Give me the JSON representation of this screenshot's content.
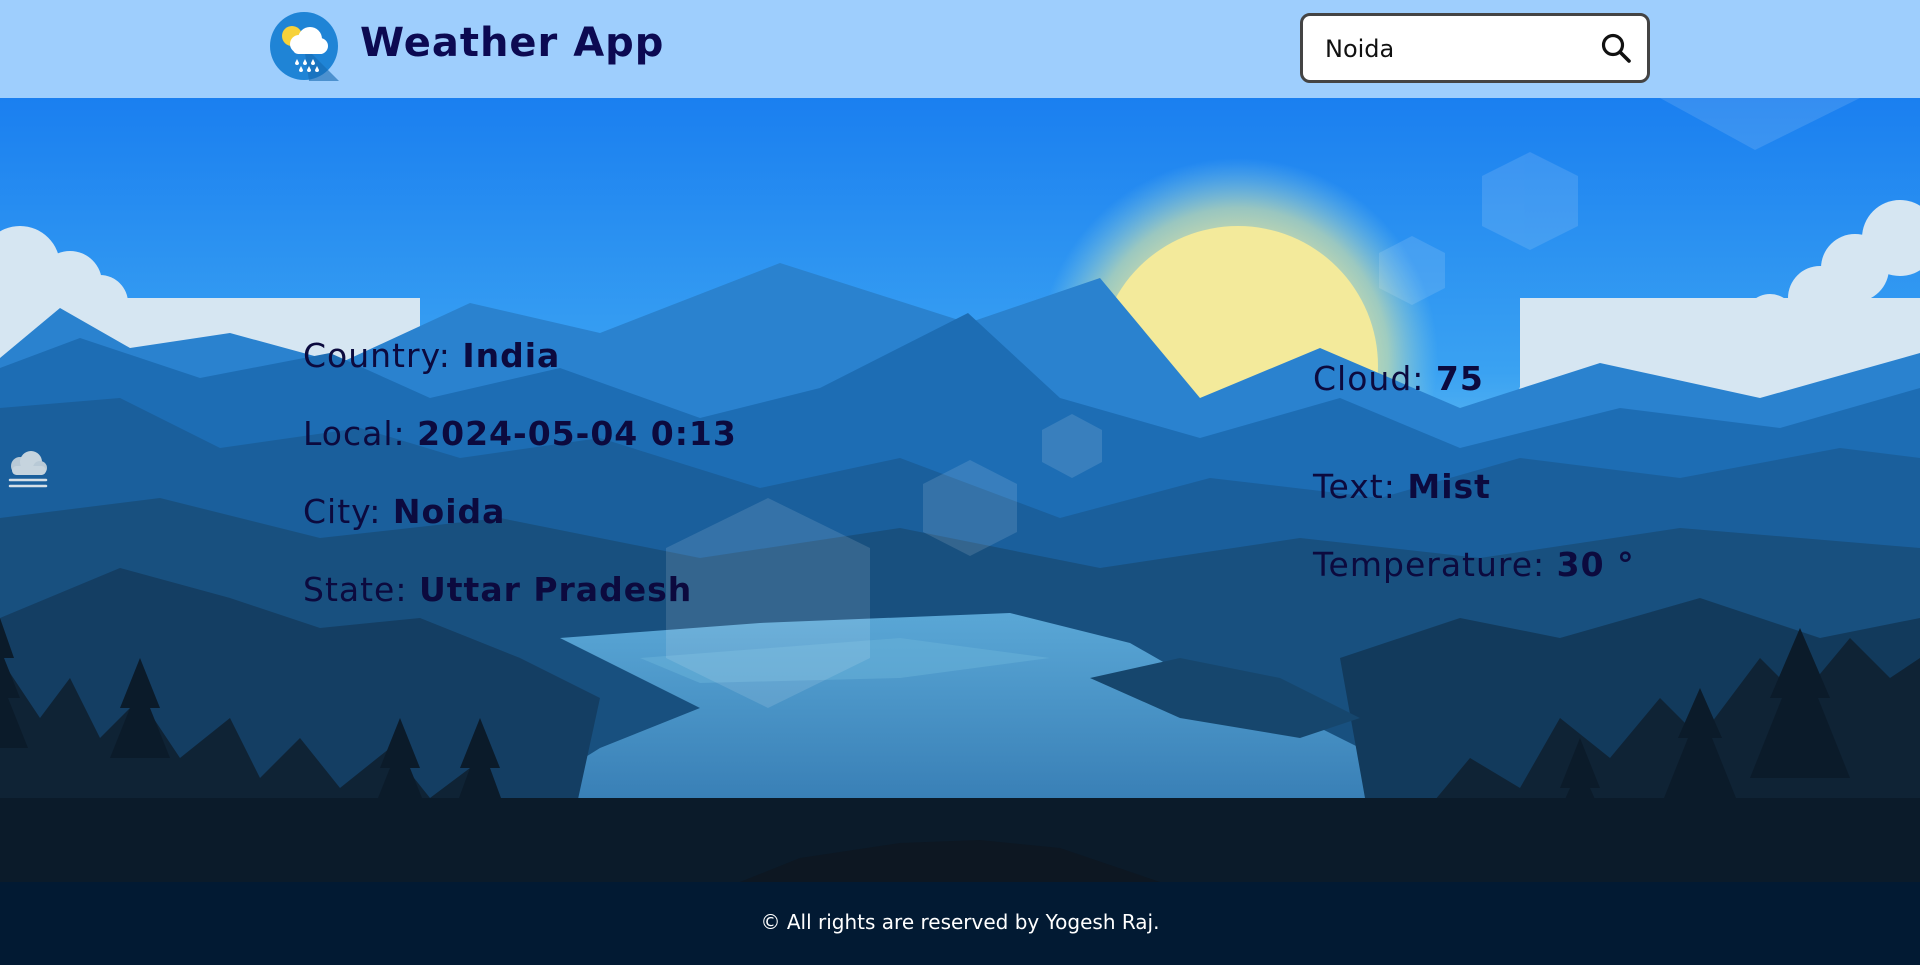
{
  "header": {
    "title": "Weather App",
    "search": {
      "value": "Noida",
      "placeholder": ""
    }
  },
  "location": {
    "country": {
      "label": "Country:",
      "value": "India"
    },
    "local": {
      "label": "Local:",
      "value": "2024-05-04 0:13"
    },
    "city": {
      "label": "City:",
      "value": "Noida"
    },
    "state": {
      "label": "State:",
      "value": "Uttar Pradesh"
    }
  },
  "weather": {
    "cloud": {
      "label": "Cloud:",
      "value": "75"
    },
    "text": {
      "label": "Text:",
      "value": "Mist",
      "icon": "mist-cloud-icon"
    },
    "temperature": {
      "label": "Temperature:",
      "value": "30 °"
    }
  },
  "footer": {
    "text": "© All rights are reserved by Yogesh Raj."
  },
  "colors": {
    "header_bg": "#9ecefd",
    "title": "#0c0a52",
    "footer_bg": "#021a33",
    "sky_top": "#1a7ff0",
    "sun": "#f3ea9b"
  }
}
